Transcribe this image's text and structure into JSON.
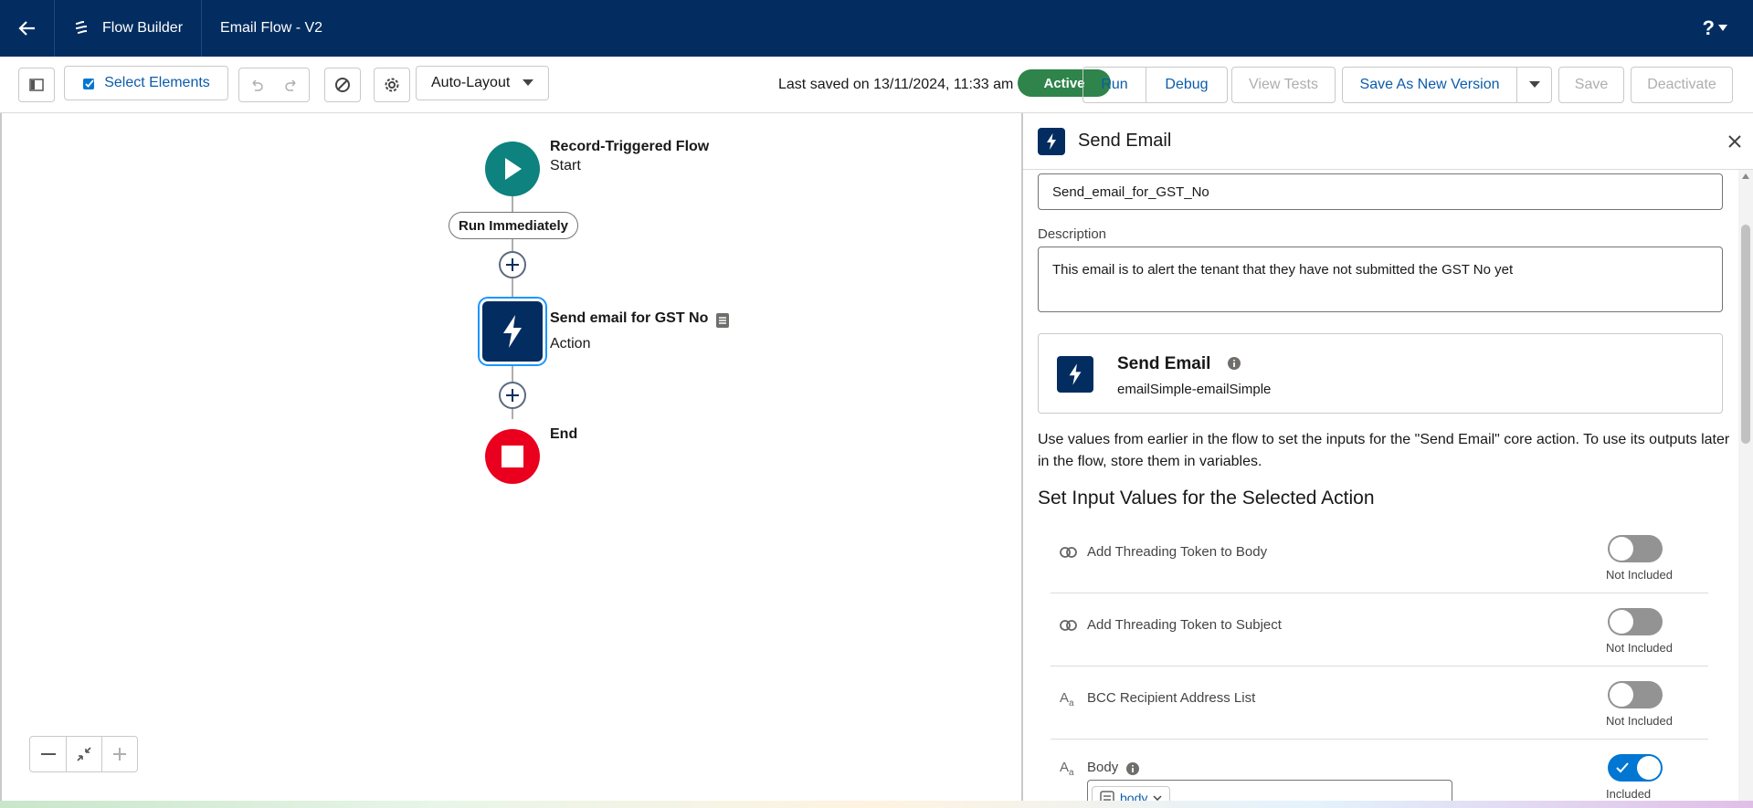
{
  "header": {
    "app_name": "Flow Builder",
    "flow_title": "Email Flow - V2",
    "help_label": "?"
  },
  "toolbar": {
    "select_elements": "Select Elements",
    "layout_value": "Auto-Layout",
    "last_saved": "Last saved on 13/11/2024, 11:33 am",
    "status_badge": "Active",
    "run": "Run",
    "debug": "Debug",
    "view_tests": "View Tests",
    "save_as_new_version": "Save As New Version",
    "save": "Save",
    "deactivate": "Deactivate"
  },
  "canvas": {
    "start": {
      "title": "Record-Triggered Flow",
      "subtitle": "Start"
    },
    "run_pill": "Run Immediately",
    "action": {
      "title": "Send email for GST No",
      "subtitle": "Action"
    },
    "end": {
      "title": "End"
    }
  },
  "panel": {
    "title": "Send Email",
    "api_name_value": "Send_email_for_GST_No",
    "description_label": "Description",
    "description_value": "This email is to alert the tenant that they have not submitted the GST No yet",
    "action_card": {
      "title": "Send Email",
      "subtitle": "emailSimple-emailSimple"
    },
    "help_text": "Use values from earlier in the flow to set the inputs for the \"Send Email\" core action. To use its outputs later in the flow, store them in variables.",
    "section_title": "Set Input Values for the Selected Action",
    "params": [
      {
        "icon": "link-icon",
        "label": "Add Threading Token to Body",
        "included": false,
        "status": "Not Included"
      },
      {
        "icon": "link-icon",
        "label": "Add Threading Token to Subject",
        "included": false,
        "status": "Not Included"
      },
      {
        "icon": "text-icon",
        "label": "BCC Recipient Address List",
        "included": false,
        "status": "Not Included"
      },
      {
        "icon": "text-icon",
        "label": "Body",
        "included": true,
        "status": "Included",
        "value": "body"
      }
    ]
  },
  "colors": {
    "header_bg": "#032d60",
    "brand_blue": "#0176d3",
    "start_node": "#0d827e",
    "end_node": "#ea001e",
    "active_badge": "#2e844a"
  }
}
